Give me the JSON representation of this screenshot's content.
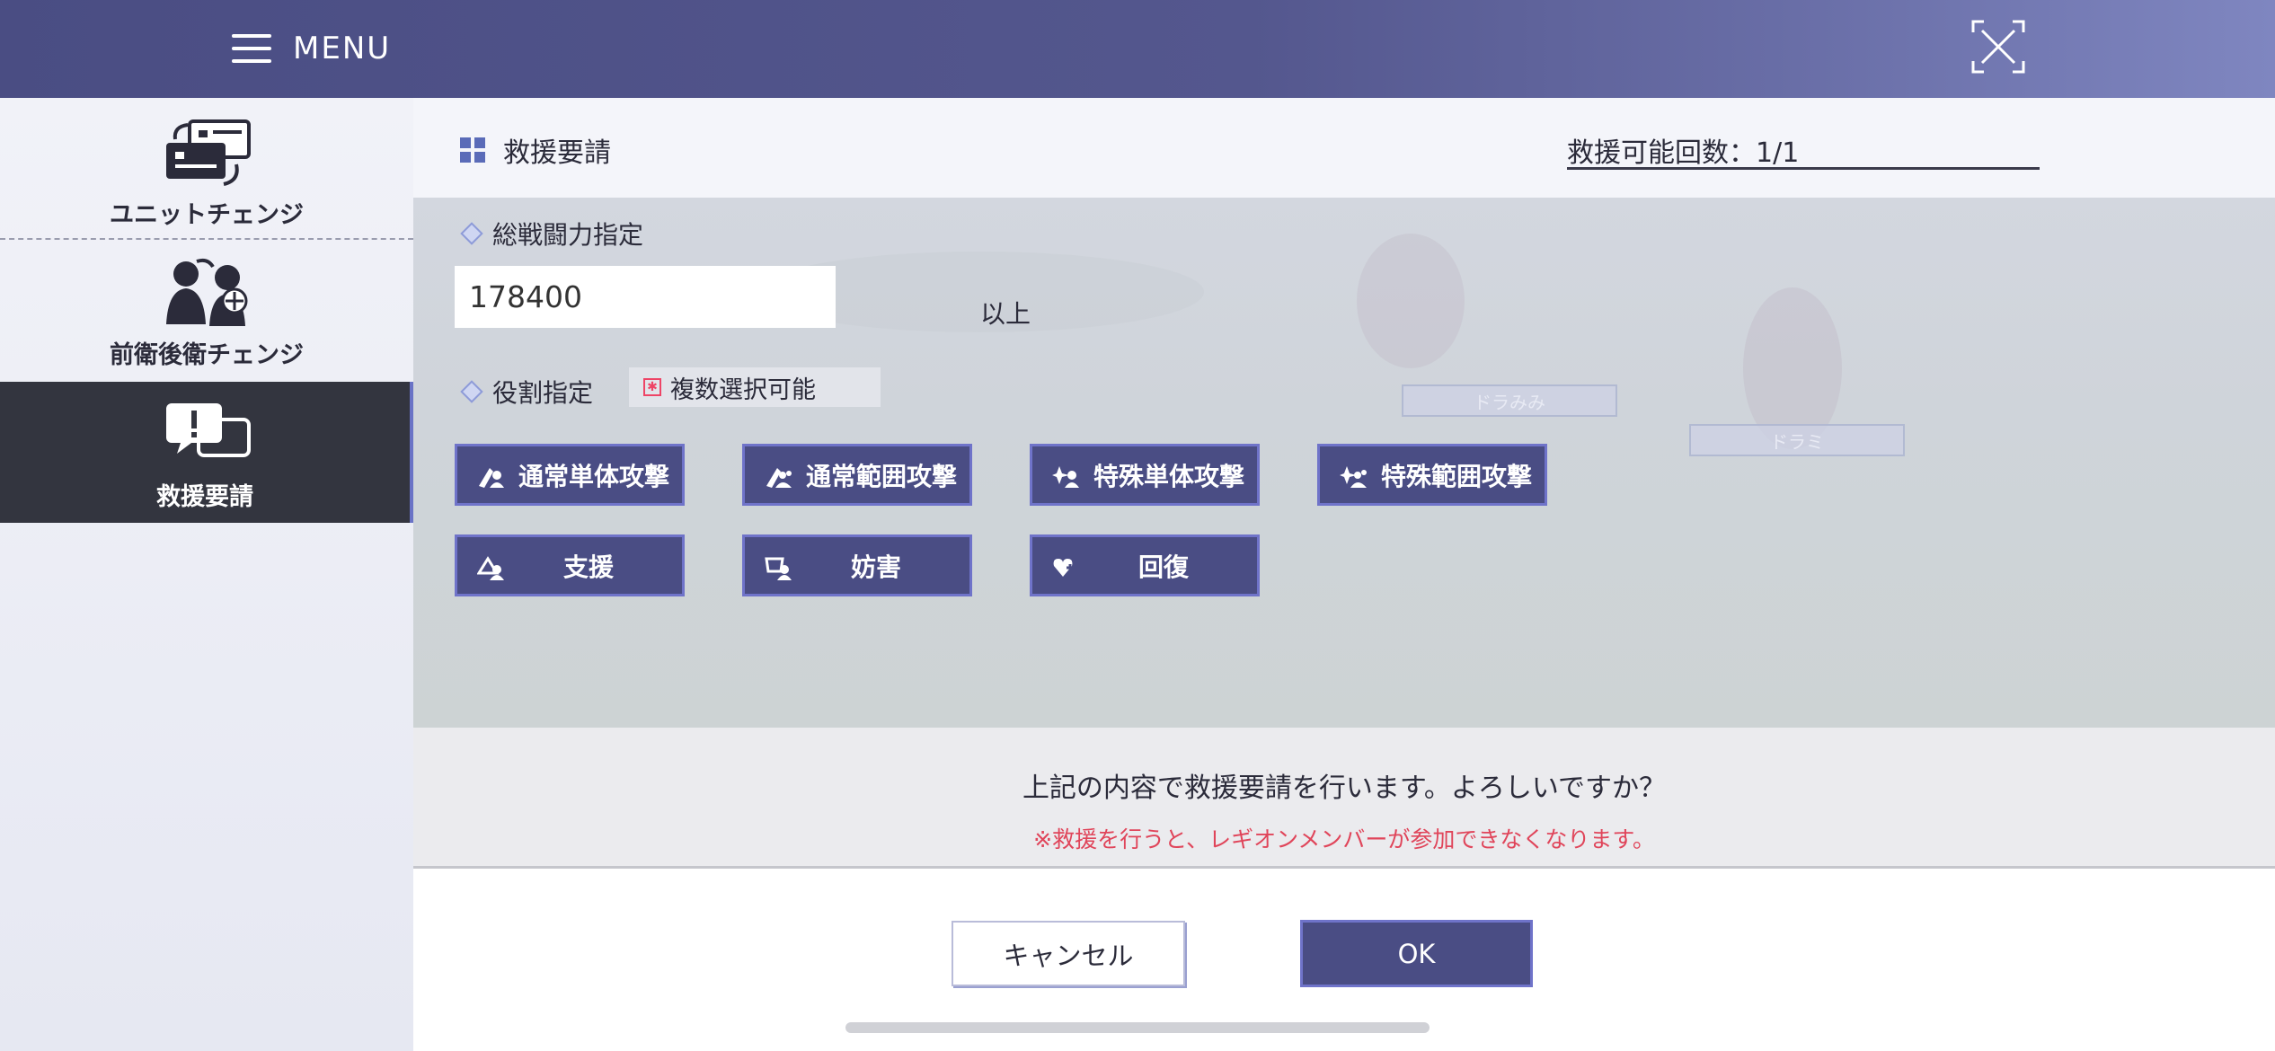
{
  "header": {
    "menu_label": "MENU",
    "menu_icon": "hamburger-icon",
    "close_icon": "close-icon"
  },
  "sidebar": {
    "items": [
      {
        "label": "ユニットチェンジ",
        "icon": "unit-change-icon",
        "active": false
      },
      {
        "label": "前衛後衛チェンジ",
        "icon": "position-change-icon",
        "active": false
      },
      {
        "label": "救援要請",
        "icon": "rescue-request-icon",
        "active": true
      }
    ]
  },
  "panel": {
    "title": "救援要請",
    "rescue_count": "救援可能回数：1/1",
    "power_section": {
      "label": "総戦闘力指定",
      "value": "178400",
      "suffix": "以上"
    },
    "role_section": {
      "label": "役割指定",
      "multi_select_badge": "複数選択可能",
      "roles": [
        {
          "label": "通常単体攻撃",
          "icon": "normal-single-attack-icon"
        },
        {
          "label": "通常範囲攻撃",
          "icon": "normal-area-attack-icon"
        },
        {
          "label": "特殊単体攻撃",
          "icon": "special-single-attack-icon"
        },
        {
          "label": "特殊範囲攻撃",
          "icon": "special-area-attack-icon"
        },
        {
          "label": "支援",
          "icon": "support-icon"
        },
        {
          "label": "妨害",
          "icon": "interference-icon"
        },
        {
          "label": "回復",
          "icon": "heal-icon"
        }
      ]
    },
    "confirm": {
      "question": "上記の内容で救援要請を行います。よろしいですか？",
      "warning": "※救援を行うと、レギオンメンバーが参加できなくなります。"
    },
    "buttons": {
      "cancel": "キャンセル",
      "ok": "OK"
    }
  },
  "background_names": [
    "ドラみみ",
    "ドラミ"
  ],
  "colors": {
    "header": "#4a4d83",
    "button_fill": "#4a4d84",
    "button_border": "#6f73c9",
    "warning_text": "#e0455a",
    "active_sidebar": "#33353f"
  }
}
